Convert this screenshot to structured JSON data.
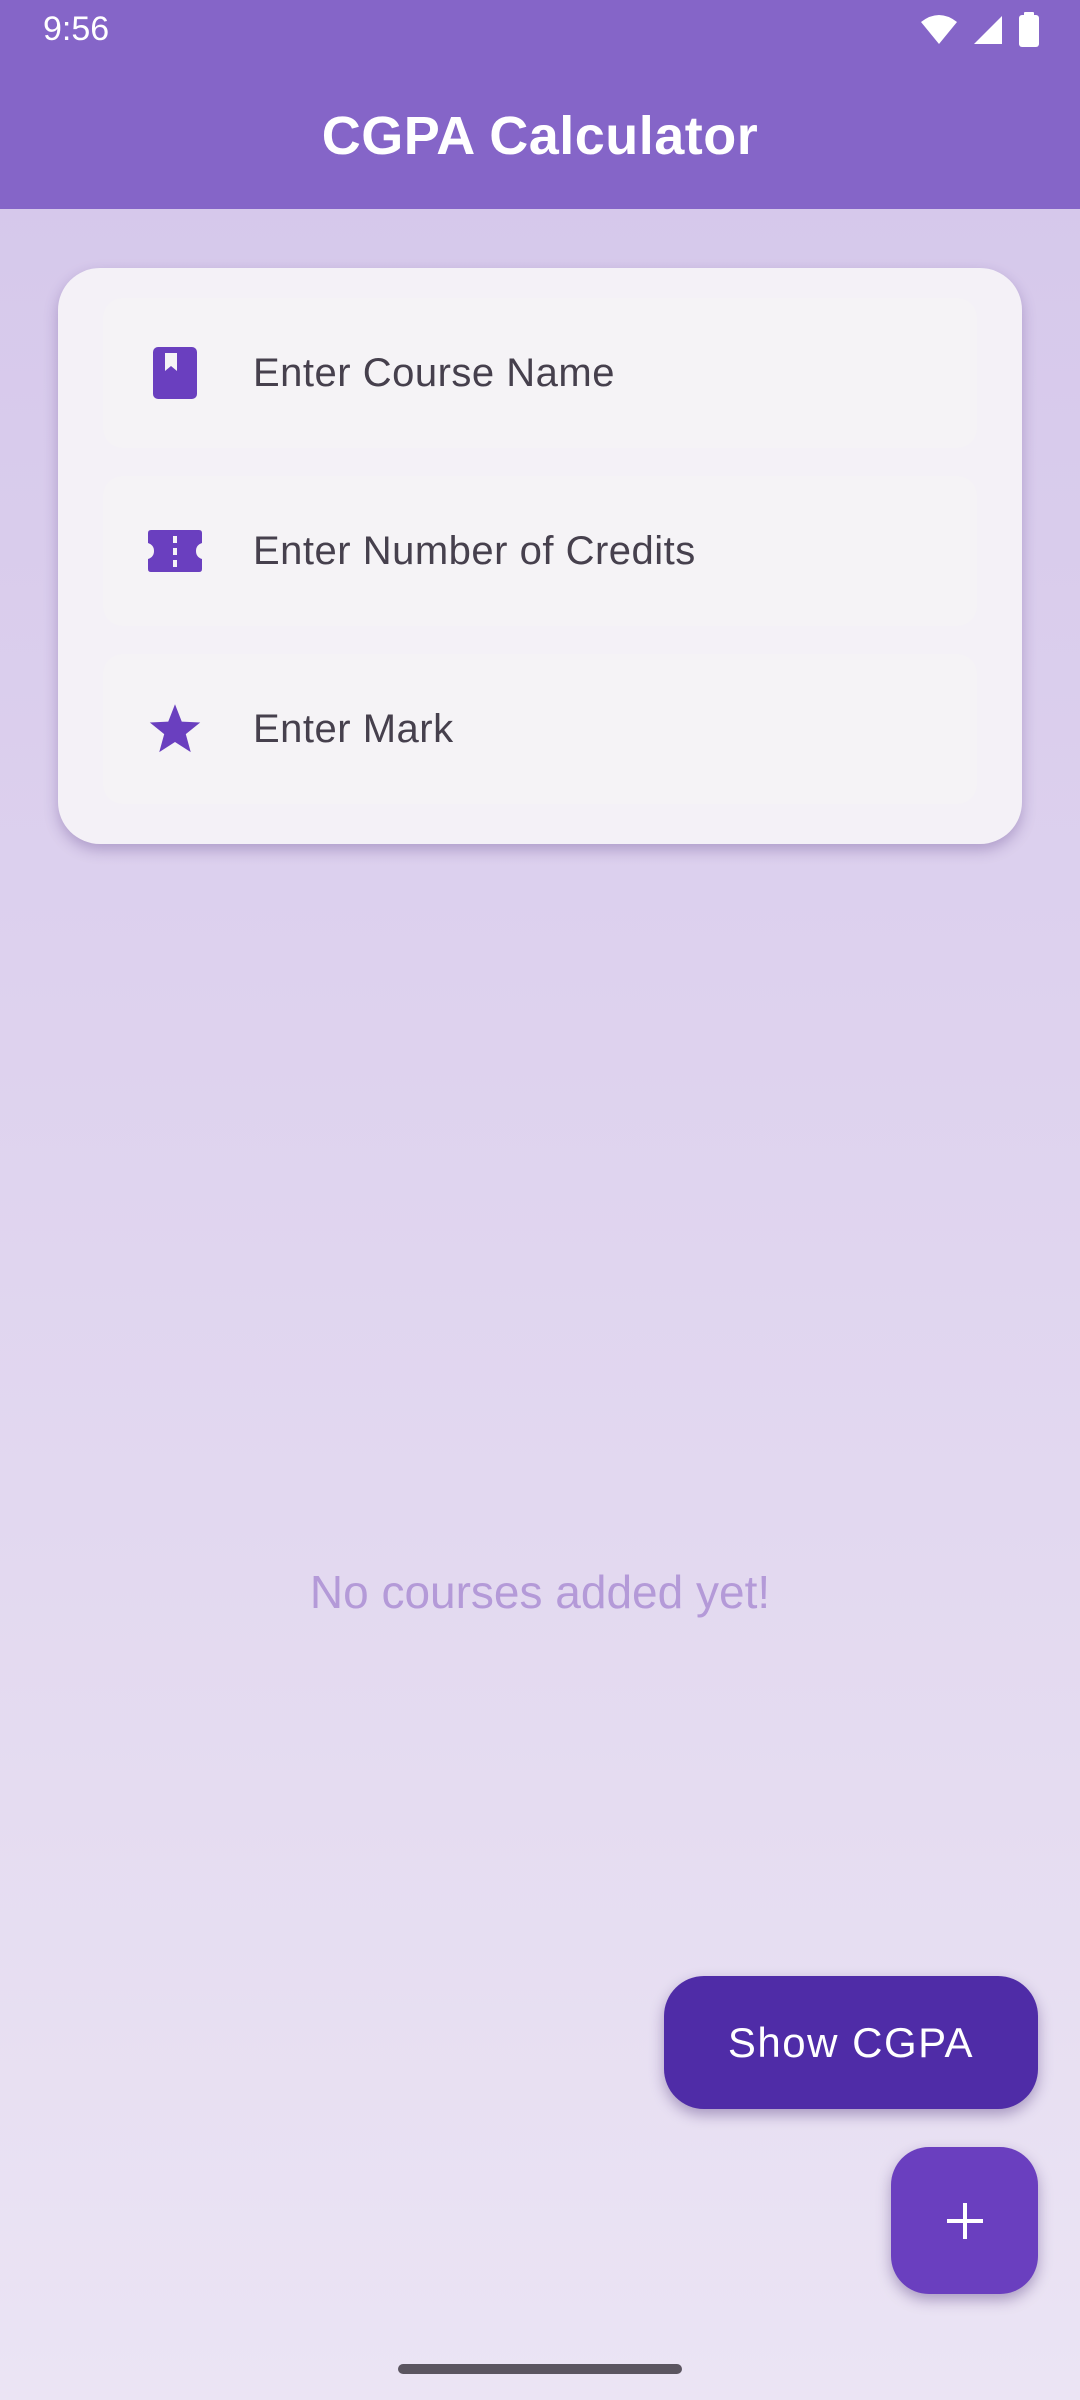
{
  "status_bar": {
    "time": "9:56",
    "icons": [
      "wifi-icon",
      "cellular-signal-icon",
      "battery-icon"
    ]
  },
  "app_bar": {
    "title": "CGPA Calculator",
    "color": "#8565c8"
  },
  "form": {
    "course_name": {
      "placeholder": "Enter Course Name",
      "value": "",
      "icon": "book-icon"
    },
    "credits": {
      "placeholder": "Enter Number of Credits",
      "value": "",
      "icon": "ticket-icon"
    },
    "mark": {
      "placeholder": "Enter Mark",
      "value": "",
      "icon": "star-icon"
    }
  },
  "empty_state": {
    "message": "No courses added yet!"
  },
  "actions": {
    "show_cgpa_label": "Show CGPA",
    "add_icon": "plus-icon"
  },
  "colors": {
    "accent": "#6a3fbf",
    "button_dark": "#4f2ca7",
    "empty_text": "#b49ad8"
  }
}
